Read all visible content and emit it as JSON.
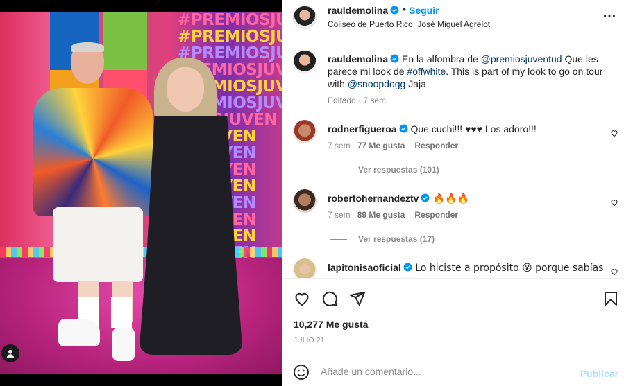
{
  "post": {
    "username": "raul demolina",
    "username_display": "rauldemolina",
    "follow_label": "Seguir",
    "dot": "•",
    "location": "Coliseo de Puerto Rico, José Miguel Agrelot"
  },
  "caption": {
    "username": "rauldemolina",
    "text_1": " En la alfombra de ",
    "mention_1": "@premiosjuventud",
    "text_2": " Que les parece mi look de ",
    "hashtag": "#offwhite",
    "text_3": ". This is part of my look to go on tour with ",
    "mention_2": "@snoopdogg",
    "text_4": " Jaja",
    "meta": "Editado · 7 sem"
  },
  "comments": [
    {
      "username": "rodnerfigueroa",
      "text": " Que cuchi!!! ♥♥♥ Los adoro!!!",
      "time": "7 sem",
      "likes": "77 Me gusta",
      "reply": "Responder",
      "view_replies": "Ver respuestas (101)"
    },
    {
      "username": "robertohernandeztv",
      "text": " 🔥🔥🔥",
      "time": "7 sem",
      "likes": "89 Me gusta",
      "reply": "Responder",
      "view_replies": "Ver respuestas (17)"
    },
    {
      "username": "lapitonisaoficial",
      "text": " Lo hiciste a propósito 😮 porque sabías"
    }
  ],
  "likes_count": "10,277 Me gusta",
  "date": "JULIO 21",
  "composer": {
    "placeholder": "Añade un comentario...",
    "publish_label": "Publicar"
  },
  "photo": {
    "backdrop_text": [
      "#PREMIOSJUVEN",
      "#PREMIOSJUVEN",
      "#PREMIOSJUVEN",
      "PREMIOSJUVEN",
      "PREMIOSJUVEN",
      "PREMIOSJUVEN",
      "MIOSJUVEN",
      "OSJUVEN",
      "OSJUVEN",
      "OSJUVEN",
      "OSJUVEN",
      "OSJUVEN",
      "OSJUVEN",
      "OSJUVEN",
      "OSJUVEN"
    ]
  },
  "colors": {
    "accent": "#0095f6",
    "publish_disabled": "#b2dffc",
    "verified": "#0095f6"
  },
  "icons": [
    "verified-badge-icon",
    "more-options-icon",
    "heart-icon",
    "comment-icon",
    "share-icon",
    "bookmark-icon",
    "emoji-icon",
    "user-tag-icon"
  ]
}
